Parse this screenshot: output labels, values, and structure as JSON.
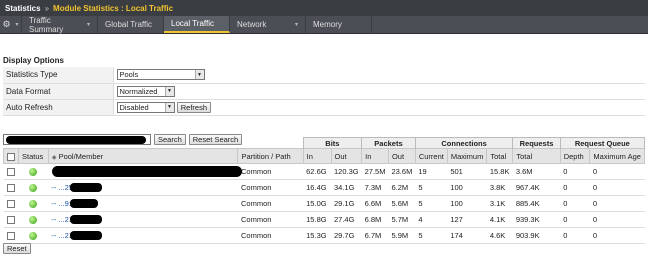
{
  "topbar": {
    "root": "Statistics",
    "separator": "»",
    "crumb": "Module Statistics : Local Traffic"
  },
  "tabs": [
    {
      "label": "Traffic Summary",
      "dropdown": true,
      "active": false
    },
    {
      "label": "Global Traffic",
      "dropdown": false,
      "active": false
    },
    {
      "label": "Local Traffic",
      "dropdown": false,
      "active": true
    },
    {
      "label": "Network",
      "dropdown": true,
      "active": false
    },
    {
      "label": "Memory",
      "dropdown": false,
      "active": false
    }
  ],
  "display_options": {
    "title": "Display Options",
    "statistics_type": {
      "label": "Statistics Type",
      "value": "Pools"
    },
    "data_format": {
      "label": "Data Format",
      "value": "Normalized"
    },
    "auto_refresh": {
      "label": "Auto Refresh",
      "value": "Disabled",
      "button": "Refresh"
    }
  },
  "search": {
    "search_button": "Search",
    "reset_search_button": "Reset Search"
  },
  "table": {
    "groups": {
      "bits": "Bits",
      "packets": "Packets",
      "connections": "Connections",
      "requests": "Requests",
      "request_queue": "Request Queue"
    },
    "headers": {
      "status": "Status",
      "pool_member": "Pool/Member",
      "partition": "Partition / Path",
      "bits_in": "In",
      "bits_out": "Out",
      "pkts_in": "In",
      "pkts_out": "Out",
      "conn_current": "Current",
      "conn_max": "Maximum",
      "conn_total": "Total",
      "req_total": "Total",
      "rq_depth": "Depth",
      "rq_maxage": "Maximum Age"
    },
    "rows": [
      {
        "member": "",
        "partition": "Common",
        "bits_in": "62.6G",
        "bits_out": "120.3G",
        "pkts_in": "27.5M",
        "pkts_out": "23.6M",
        "current": "19",
        "maximum": "501",
        "total": "15.8K",
        "requests": "3.6M",
        "depth": "0",
        "max_age": "0"
      },
      {
        "member": "--  ...254:7010",
        "partition": "Common",
        "bits_in": "16.4G",
        "bits_out": "34.1G",
        "pkts_in": "7.3M",
        "pkts_out": "6.2M",
        "current": "5",
        "maximum": "100",
        "total": "3.8K",
        "requests": "967.4K",
        "depth": "0",
        "max_age": "0"
      },
      {
        "member": "--  ...9:7010",
        "partition": "Common",
        "bits_in": "15.0G",
        "bits_out": "29.1G",
        "pkts_in": "6.6M",
        "pkts_out": "5.6M",
        "current": "5",
        "maximum": "100",
        "total": "3.1K",
        "requests": "885.4K",
        "depth": "0",
        "max_age": "0"
      },
      {
        "member": "--  ...217:7010",
        "partition": "Common",
        "bits_in": "15.8G",
        "bits_out": "27.4G",
        "pkts_in": "6.8M",
        "pkts_out": "5.7M",
        "current": "4",
        "maximum": "127",
        "total": "4.1K",
        "requests": "939.3K",
        "depth": "0",
        "max_age": "0"
      },
      {
        "member": "--  ...218:7010",
        "partition": "Common",
        "bits_in": "15.3G",
        "bits_out": "29.7G",
        "pkts_in": "6.7M",
        "pkts_out": "5.9M",
        "current": "5",
        "maximum": "174",
        "total": "4.6K",
        "requests": "903.9K",
        "depth": "0",
        "max_age": "0"
      }
    ]
  },
  "reset_button": "Reset",
  "icons": {
    "settings": "gear-icon",
    "status": "green-status-icon",
    "sort": "sort-icon",
    "dropdown": "chevron-down-icon"
  }
}
